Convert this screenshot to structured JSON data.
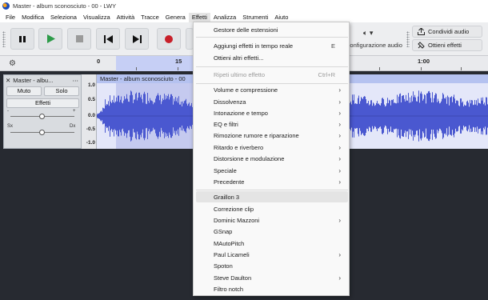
{
  "window": {
    "title": "Master - album sconosciuto - 00 - LWY"
  },
  "menubar": [
    "File",
    "Modifica",
    "Seleziona",
    "Visualizza",
    "Attività",
    "Tracce",
    "Genera",
    "Effetti",
    "Analizza",
    "Strumenti",
    "Aiuto"
  ],
  "active_menu": "Effetti",
  "toolbar": {
    "audio_setup_label": "Configurazione audio",
    "share_audio_label": "Condividi audio",
    "get_effects_label": "Ottieni effetti"
  },
  "ruler": {
    "ticks": [
      "0",
      "15",
      "1:00"
    ]
  },
  "track": {
    "name": "Master - album sconosciuto - 00",
    "short_name": "Master - albu...",
    "mute_label": "Muto",
    "solo_label": "Solo",
    "effects_label": "Effetti",
    "gain_minus": "-",
    "gain_plus": "+",
    "pan_left": "Sx",
    "pan_right": "Dx",
    "scale": [
      "1.0",
      "0.5",
      "0.0",
      "-0.5",
      "-1.0"
    ]
  },
  "effects_menu": {
    "items": [
      {
        "label": "Gestore delle estensioni"
      },
      {
        "label": "Aggiungi effetti in tempo reale",
        "shortcut": "E"
      },
      {
        "label": "Ottieni altri effetti..."
      },
      {
        "label": "Ripeti ultimo effetto",
        "shortcut": "Ctrl+R",
        "disabled": true
      },
      {
        "label": "Volume e compressione",
        "submenu": true
      },
      {
        "label": "Dissolvenza",
        "submenu": true
      },
      {
        "label": "Intonazione e tempo",
        "submenu": true
      },
      {
        "label": "EQ e filtri",
        "submenu": true
      },
      {
        "label": "Rimozione rumore e riparazione",
        "submenu": true
      },
      {
        "label": "Ritardo e riverbero",
        "submenu": true
      },
      {
        "label": "Distorsione e modulazione",
        "submenu": true
      },
      {
        "label": "Speciale",
        "submenu": true
      },
      {
        "label": "Precedente",
        "submenu": true
      },
      {
        "label": "Graillon 3",
        "highlighted": true
      },
      {
        "label": "Correzione clip"
      },
      {
        "label": "Dominic Mazzoni",
        "submenu": true
      },
      {
        "label": "GSnap"
      },
      {
        "label": "MAutoPitch"
      },
      {
        "label": "Paul Licameli",
        "submenu": true
      },
      {
        "label": "Spoton"
      },
      {
        "label": "Steve Daulton",
        "submenu": true
      },
      {
        "label": "Filtro notch"
      }
    ]
  },
  "colors": {
    "waveform": "#4a58d0",
    "selection": "#c6cff5",
    "record": "#c8202a",
    "play": "#2d9b49"
  }
}
